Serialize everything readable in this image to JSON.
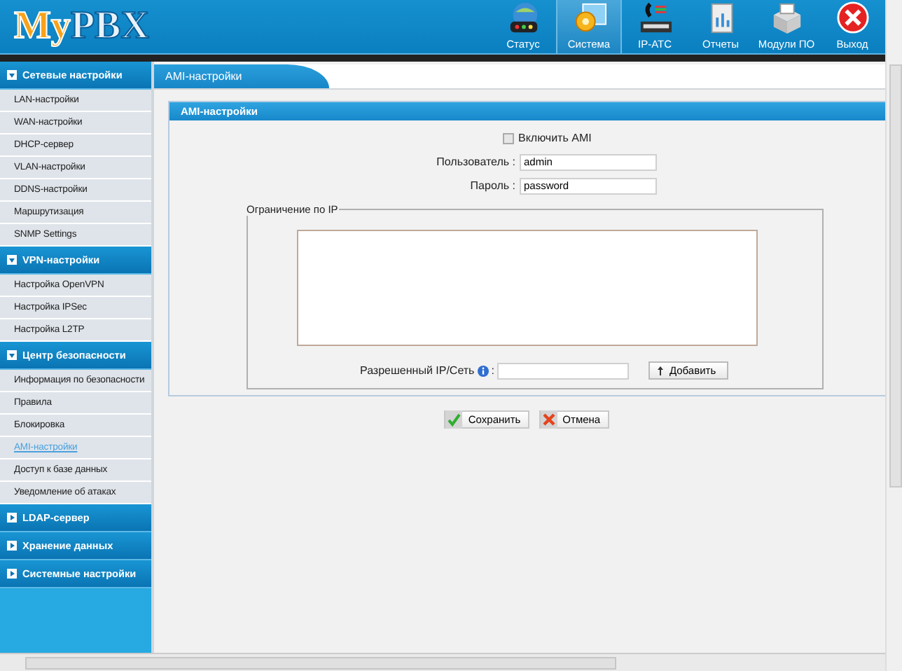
{
  "header": {
    "logo_parts": [
      "My",
      "PBX"
    ],
    "nav": [
      {
        "label": "Статус",
        "kind": "status",
        "selected": false
      },
      {
        "label": "Система",
        "kind": "system",
        "selected": true
      },
      {
        "label": "IP-АТС",
        "kind": "pbx",
        "selected": false
      },
      {
        "label": "Отчеты",
        "kind": "reports",
        "selected": false
      },
      {
        "label": "Модули ПО",
        "kind": "modules",
        "selected": false
      },
      {
        "label": "Выход",
        "kind": "exit",
        "selected": false
      }
    ]
  },
  "sidebar": {
    "groups": [
      {
        "title": "Сетевые настройки",
        "expanded": true,
        "items": [
          {
            "label": "LAN-настройки",
            "selected": false
          },
          {
            "label": "WAN-настройки",
            "selected": false
          },
          {
            "label": "DHCP-сервер",
            "selected": false
          },
          {
            "label": "VLAN-настройки",
            "selected": false
          },
          {
            "label": "DDNS-настройки",
            "selected": false
          },
          {
            "label": "Маршрутизация",
            "selected": false
          },
          {
            "label": "SNMP Settings",
            "selected": false
          }
        ]
      },
      {
        "title": "VPN-настройки",
        "expanded": true,
        "items": [
          {
            "label": "Настройка OpenVPN",
            "selected": false
          },
          {
            "label": "Настройка IPSec",
            "selected": false
          },
          {
            "label": "Настройка L2TP",
            "selected": false
          }
        ]
      },
      {
        "title": "Центр безопасности",
        "expanded": true,
        "items": [
          {
            "label": "Информация по безопасности",
            "selected": false
          },
          {
            "label": "Правила",
            "selected": false
          },
          {
            "label": "Блокировка",
            "selected": false
          },
          {
            "label": "AMI-настройки",
            "selected": true
          },
          {
            "label": "Доступ к базе данных",
            "selected": false
          },
          {
            "label": "Уведомление об атаках",
            "selected": false
          }
        ]
      },
      {
        "title": "LDAP-сервер",
        "expanded": false
      },
      {
        "title": "Хранение данных",
        "expanded": false
      },
      {
        "title": "Системные настройки",
        "expanded": false
      }
    ]
  },
  "page_tab": "AMI-настройки",
  "panel": {
    "title": "AMI-настройки",
    "enable_ami": {
      "label": "Включить AMI",
      "checked": false
    },
    "user": {
      "label": "Пользователь :",
      "value": "admin"
    },
    "password": {
      "label": "Пароль :",
      "value": "password"
    },
    "ip_restriction": {
      "legend": "Ограничение по IP",
      "allowed_label": "Разрешенный IP/Сеть",
      "separator": ":",
      "add_button": "Добавить"
    }
  },
  "buttons": [
    {
      "label": "Сохранить",
      "kind": "save"
    },
    {
      "label": "Отмена",
      "kind": "cancel"
    }
  ]
}
